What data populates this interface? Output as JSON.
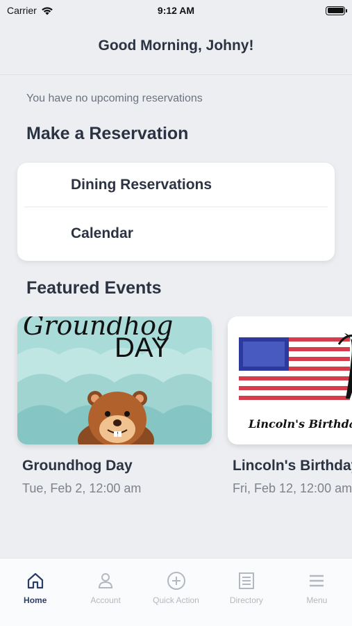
{
  "status": {
    "carrier": "Carrier",
    "time": "9:12 AM"
  },
  "header": {
    "greeting": "Good Morning, Johny!"
  },
  "reservations": {
    "empty_text": "You have no upcoming reservations"
  },
  "make_reservation": {
    "title": "Make a Reservation",
    "items": [
      {
        "label": "Dining Reservations"
      },
      {
        "label": "Calendar"
      }
    ]
  },
  "featured": {
    "title": "Featured Events",
    "events": [
      {
        "name": "Groundhog Day",
        "date": "Tue, Feb 2, 12:00 am",
        "image_text_top": "Groundhog",
        "image_text": "DAY"
      },
      {
        "name": "Lincoln's Birthday",
        "date": "Fri, Feb 12, 12:00 am",
        "image_text": "Lincoln's Birthday"
      }
    ]
  },
  "tabs": [
    {
      "label": "Home",
      "icon": "home-icon",
      "active": true
    },
    {
      "label": "Account",
      "icon": "account-icon",
      "active": false
    },
    {
      "label": "Quick Action",
      "icon": "plus-circle-icon",
      "active": false
    },
    {
      "label": "Directory",
      "icon": "directory-icon",
      "active": false
    },
    {
      "label": "Menu",
      "icon": "menu-icon",
      "active": false
    }
  ],
  "colors": {
    "background": "#eceef1",
    "text": "#2b3342",
    "active_tab": "#2b3d66",
    "inactive_tab": "#b3b8c0"
  }
}
